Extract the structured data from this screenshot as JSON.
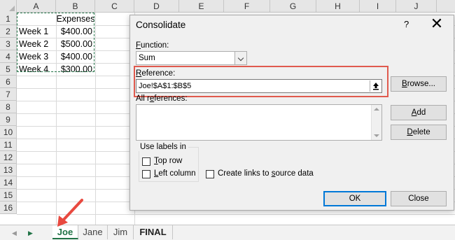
{
  "sheet": {
    "columns": [
      "A",
      "B",
      "C",
      "D",
      "E",
      "F",
      "G",
      "H",
      "I",
      "J"
    ],
    "rows": [
      "1",
      "2",
      "3",
      "4",
      "5",
      "6",
      "7",
      "8",
      "9",
      "10",
      "11",
      "12",
      "13",
      "14",
      "15",
      "16"
    ],
    "header_label": "Expenses",
    "data": [
      {
        "label": "Week 1",
        "value": "$400.00"
      },
      {
        "label": "Week 2",
        "value": "$500.00"
      },
      {
        "label": "Week 3",
        "value": "$400.00"
      },
      {
        "label": "Week 4",
        "value": "$300.00"
      }
    ]
  },
  "tabs": [
    "Joe",
    "Jane",
    "Jim",
    "FINAL"
  ],
  "active_tab": "Joe",
  "dialog": {
    "title": "Consolidate",
    "help": "?",
    "close": "✕",
    "function_label_pre": "",
    "function_label_u": "F",
    "function_label_post": "unction:",
    "function_value": "Sum",
    "reference_label_pre": "",
    "reference_label_u": "R",
    "reference_label_post": "eference:",
    "reference_value": "Joe!$A$1:$B$5",
    "all_references_pre": "All r",
    "all_references_u": "e",
    "all_references_post": "ferences:",
    "browse_pre": "",
    "browse_u": "B",
    "browse_post": "rowse...",
    "add_pre": "",
    "add_u": "A",
    "add_post": "dd",
    "delete_pre": "",
    "delete_u": "D",
    "delete_post": "elete",
    "use_labels": "Use labels in",
    "top_row_pre": "",
    "top_row_u": "T",
    "top_row_post": "op row",
    "left_column_pre": "",
    "left_column_u": "L",
    "left_column_post": "eft column",
    "create_links_pre": "Create links to ",
    "create_links_u": "s",
    "create_links_post": "ource data",
    "ok": "OK",
    "close_button": "Close"
  },
  "colors": {
    "excel_green": "#217346",
    "highlight_red": "#e05a4e",
    "arrow_red": "#e8493f"
  }
}
